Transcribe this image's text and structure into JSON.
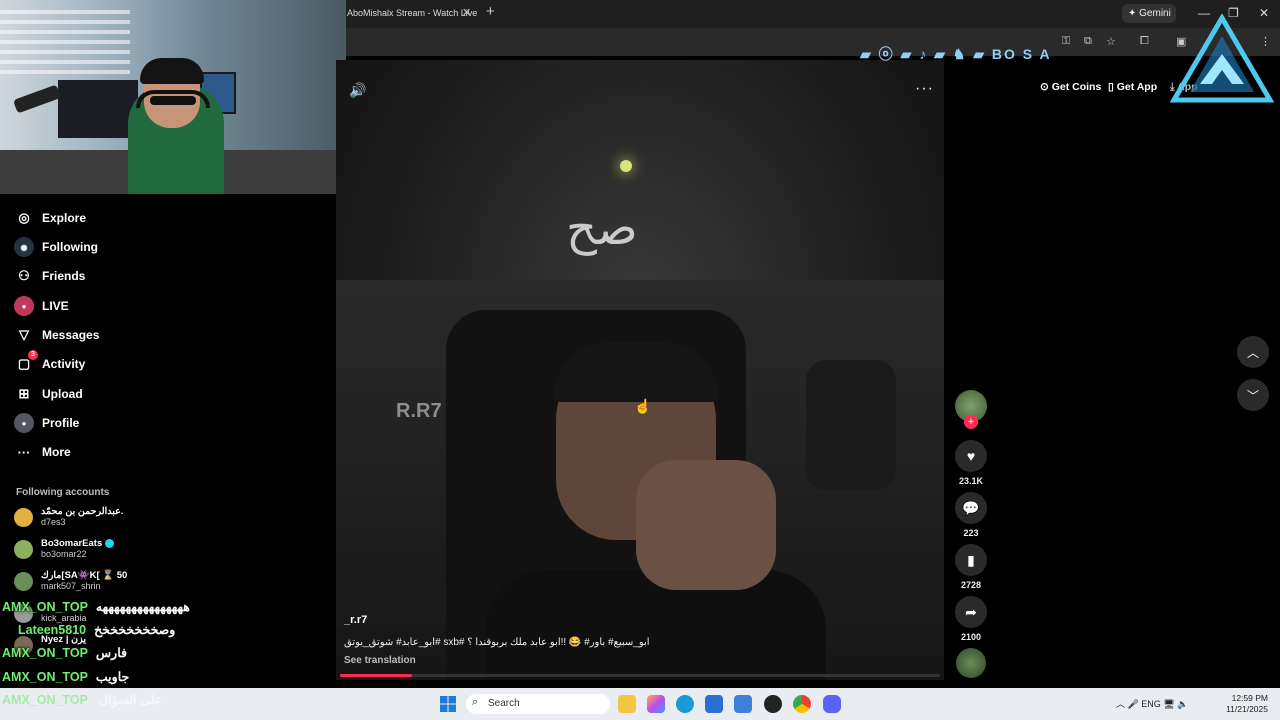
{
  "browser": {
    "tab_title": "AboMishalx Stream - Watch Live",
    "new_tab": "+",
    "gemini": "✦ Gemini",
    "win_minimize": "—",
    "win_maximize": "❐",
    "win_close": "✕"
  },
  "sidebar": {
    "items": [
      {
        "label": "Explore",
        "icon": "compass-icon",
        "glyph": "◎"
      },
      {
        "label": "Following",
        "icon": "following-avatar-icon",
        "glyph": "◉"
      },
      {
        "label": "Friends",
        "icon": "friends-icon",
        "glyph": "⚇"
      },
      {
        "label": "LIVE",
        "icon": "live-avatar-icon",
        "glyph": "●"
      },
      {
        "label": "Messages",
        "icon": "messages-icon",
        "glyph": "▽"
      },
      {
        "label": "Activity",
        "icon": "activity-icon",
        "glyph": "▢",
        "badge": "3"
      },
      {
        "label": "Upload",
        "icon": "upload-icon",
        "glyph": "⊞"
      },
      {
        "label": "Profile",
        "icon": "profile-avatar-icon",
        "glyph": "●"
      },
      {
        "label": "More",
        "icon": "more-icon",
        "glyph": "···"
      }
    ],
    "following_title": "Following accounts",
    "accounts": [
      {
        "name": "عبدالرحمن بن محمّد.",
        "user": "d7es3",
        "color": "#e0b040"
      },
      {
        "name": "Bo3omarEats",
        "user": "bo3omar22",
        "color": "#8ab060",
        "verified": true
      },
      {
        "name": "مارك[SA👾K[ ⌛ 50",
        "user": "mark507_shrin",
        "color": "#6a8f58"
      },
      {
        "name": "",
        "user": "kick_arabia",
        "color": "#9a9a9a"
      },
      {
        "name": "Nyez | يزن",
        "user": "",
        "color": "#7a6a5a"
      }
    ]
  },
  "chat_overlay": [
    {
      "user": "AMX_ON_TOP",
      "msg": "هههههههههههههههه"
    },
    {
      "user": "Lateen5810",
      "msg": "وصخخخخخخخخ"
    },
    {
      "user": "AMX_ON_TOP",
      "msg": "فارس"
    },
    {
      "user": "AMX_ON_TOP",
      "msg": "جاويب"
    },
    {
      "user": "AMX_ON_TOP",
      "msg": "على السؤال"
    }
  ],
  "video": {
    "overlay_text": "صح",
    "watermark": "R.R7",
    "author": "_r.r7",
    "caption": "ابو_عابد# شوتق_يوتق# sxb# ابو_سبيع# باور# 😂 !!ابو عابد ملك بربوقندا ؟",
    "see_translation": "See translation",
    "progress": 0.12,
    "more": "···"
  },
  "actions": {
    "likes": "23.1K",
    "comments": "223",
    "saves": "2728",
    "shares": "2100"
  },
  "topbar": {
    "get_coins": "⊙ Get Coins",
    "get_app": "▯ Get App",
    "app_cut": "⤓ App",
    "social_strip": "▰ ⓞ ▰ ♪ ▰ ♞ ▰  BO  S  A"
  },
  "taskbar": {
    "search_placeholder": "Search",
    "tray": "︿  🎤  ENG  🖥 🔈",
    "time": "12:59 PM",
    "date": "11/21/2025"
  },
  "colors": {
    "accent": "#fe2c55",
    "chat_user": "#6ef06e",
    "taskbar": "#e9edf2"
  }
}
